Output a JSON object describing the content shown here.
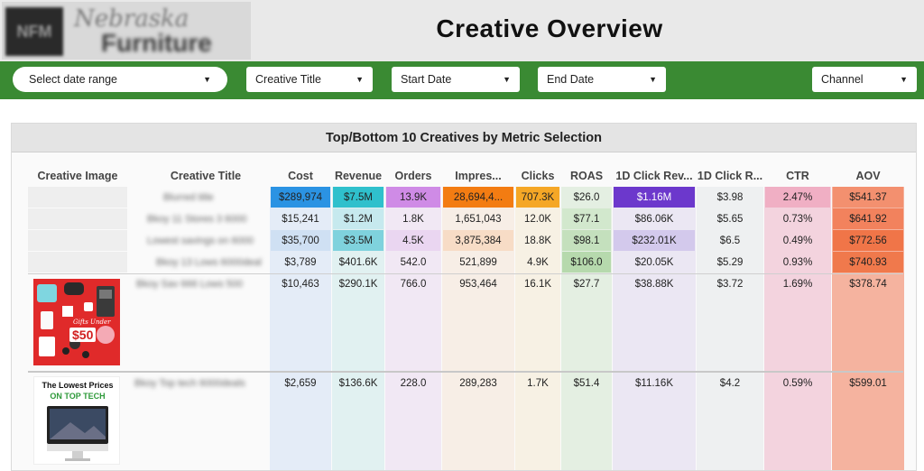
{
  "header": {
    "title": "Creative Overview",
    "logo_abbr": "NFM",
    "logo_line1": "Nebraska",
    "logo_line2": "Furniture Mart"
  },
  "filters": [
    {
      "label": "Select date range",
      "type": "pill"
    },
    {
      "label": "Creative Title"
    },
    {
      "label": "Start Date"
    },
    {
      "label": "End Date"
    },
    {
      "label": "Channel"
    }
  ],
  "table": {
    "title": "Top/Bottom 10 Creatives by Metric Selection",
    "columns": [
      "Creative Image",
      "Creative Title",
      "Cost",
      "Revenue",
      "Orders",
      "Impres...",
      "Clicks",
      "ROAS",
      "1D Click Rev...",
      "1D Click R...",
      "CTR",
      "AOV"
    ],
    "rows": [
      [
        "$289,974",
        "$7.5M",
        "13.9K",
        "28,694,4...",
        "707.3K",
        "$26.0",
        "$1.16M",
        "$3.98",
        "2.47%",
        "$541.37"
      ],
      [
        "$15,241",
        "$1.2M",
        "1.8K",
        "1,651,043",
        "12.0K",
        "$77.1",
        "$86.06K",
        "$5.65",
        "0.73%",
        "$641.92"
      ],
      [
        "$35,700",
        "$3.5M",
        "4.5K",
        "3,875,384",
        "18.8K",
        "$98.1",
        "$232.01K",
        "$6.5",
        "0.49%",
        "$772.56"
      ],
      [
        "$3,789",
        "$401.6K",
        "542.0",
        "521,899",
        "4.9K",
        "$106.0",
        "$20.05K",
        "$5.29",
        "0.93%",
        "$740.93"
      ],
      [
        "$10,463",
        "$290.1K",
        "766.0",
        "953,464",
        "16.1K",
        "$27.7",
        "$38.88K",
        "$3.72",
        "1.69%",
        "$378.74"
      ],
      [
        "$2,659",
        "$136.6K",
        "228.0",
        "289,283",
        "1.7K",
        "$51.4",
        "$11.16K",
        "$4.2",
        "0.59%",
        "$599.01"
      ]
    ],
    "blurred_titles": [
      "Blurred title",
      "Bkoy 11 Stores 3 6000",
      "Lowest savings on 6000",
      "Bkoy 13 Lows 6000deal",
      "Bkoy Sav 666 Lows 500",
      "Bkoy Top tech 6000deals"
    ]
  },
  "thumb1": {
    "line1": "Gifts Under",
    "price": "$50"
  },
  "thumb2": {
    "line1": "The Lowest Prices",
    "line2": "ON TOP TECH"
  },
  "colors": {
    "brand_green": "#3a8a33",
    "cost_heat": "#1e8fe0",
    "revenue_heat": "#2ab7c8",
    "orders_heat": "#c982e0",
    "impressions_heat": "#f07a14",
    "clicks_heat": "#f5a623",
    "rev1d_heat": "#6a35c9",
    "ctr_heat": "#f2b6c9",
    "aov_heat": "#f08a6a"
  }
}
